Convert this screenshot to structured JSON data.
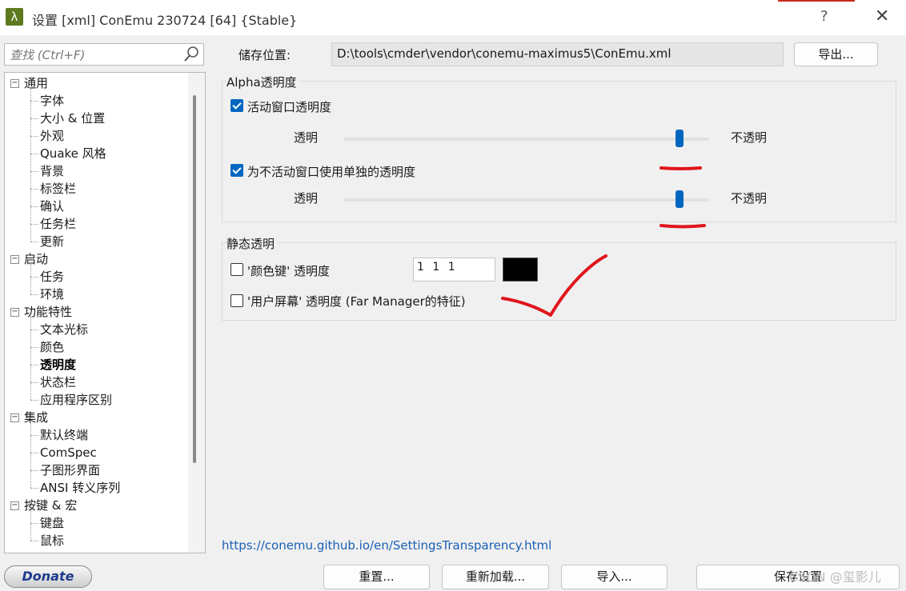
{
  "window": {
    "title": "设置 [xml] ConEmu 230724 [64] {Stable}",
    "app_icon_glyph": "λ",
    "help_glyph": "?",
    "close_glyph": "✕"
  },
  "search": {
    "placeholder": "查找 (Ctrl+F)"
  },
  "tree": {
    "selected": "透明度",
    "items": [
      {
        "label": "通用",
        "level": 0,
        "expanded": true
      },
      {
        "label": "字体",
        "level": 1
      },
      {
        "label": "大小 & 位置",
        "level": 1
      },
      {
        "label": "外观",
        "level": 1
      },
      {
        "label": "Quake 风格",
        "level": 1
      },
      {
        "label": "背景",
        "level": 1
      },
      {
        "label": "标签栏",
        "level": 1
      },
      {
        "label": "确认",
        "level": 1
      },
      {
        "label": "任务栏",
        "level": 1
      },
      {
        "label": "更新",
        "level": 1
      },
      {
        "label": "启动",
        "level": 0,
        "expanded": true
      },
      {
        "label": "任务",
        "level": 1
      },
      {
        "label": "环境",
        "level": 1
      },
      {
        "label": "功能特性",
        "level": 0,
        "expanded": true
      },
      {
        "label": "文本光标",
        "level": 1
      },
      {
        "label": "颜色",
        "level": 1
      },
      {
        "label": "透明度",
        "level": 1,
        "selected": true
      },
      {
        "label": "状态栏",
        "level": 1
      },
      {
        "label": "应用程序区别",
        "level": 1
      },
      {
        "label": "集成",
        "level": 0,
        "expanded": true
      },
      {
        "label": "默认终端",
        "level": 1
      },
      {
        "label": "ComSpec",
        "level": 1
      },
      {
        "label": "子图形界面",
        "level": 1
      },
      {
        "label": "ANSI 转义序列",
        "level": 1
      },
      {
        "label": "按键 & 宏",
        "level": 0,
        "expanded": true
      },
      {
        "label": "键盘",
        "level": 1
      },
      {
        "label": "鼠标",
        "level": 1
      }
    ]
  },
  "storage": {
    "label": "储存位置:",
    "path": "D:\\tools\\cmder\\vendor\\conemu-maximus5\\ConEmu.xml",
    "export_label": "导出..."
  },
  "alpha_group": {
    "title": "Alpha透明度",
    "active": {
      "label": "活动窗口透明度",
      "checked": true,
      "left_label": "透明",
      "right_label": "不透明",
      "value_fraction": 0.92
    },
    "inactive": {
      "label": "为不活动窗口使用单独的透明度",
      "checked": true,
      "left_label": "透明",
      "right_label": "不透明",
      "value_fraction": 0.92
    }
  },
  "static_group": {
    "title": "静态透明",
    "colorkey": {
      "label": "'颜色键' 透明度",
      "checked": false,
      "value": "1 1 1",
      "swatch_color": "#000000"
    },
    "userscreen": {
      "label": "'用户屏幕' 透明度 (Far Manager的特征)",
      "checked": false
    }
  },
  "help_link": "https://conemu.github.io/en/SettingsTransparency.html",
  "buttons": {
    "donate": "Donate",
    "reset": "重置...",
    "reload": "重新加载...",
    "import": "导入...",
    "save": "保存设置"
  },
  "watermark": "CSDN @玺影儿",
  "colors": {
    "accent": "#0067c0",
    "annotation": "#e0151b",
    "link": "#1a5fb4"
  }
}
